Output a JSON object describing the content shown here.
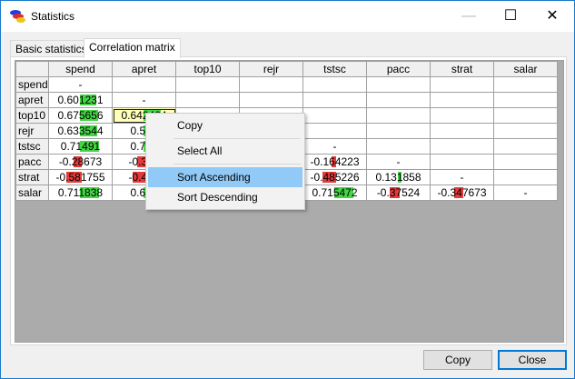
{
  "window": {
    "title": "Statistics"
  },
  "titlebar": {
    "minimize": "—",
    "maximize": "☐",
    "close": "✕"
  },
  "tabs": [
    {
      "label": "Basic statistics",
      "active": false
    },
    {
      "label": "Correlation matrix",
      "active": true
    }
  ],
  "matrix": {
    "columns": [
      "spend",
      "apret",
      "top10",
      "rejr",
      "tstsc",
      "pacc",
      "strat",
      "salar"
    ],
    "rows": [
      {
        "name": "spend",
        "cells": [
          "-",
          "",
          "",
          "",
          "",
          "",
          "",
          ""
        ]
      },
      {
        "name": "apret",
        "cells": [
          "0.601231",
          "-",
          "",
          "",
          "",
          "",
          "",
          ""
        ]
      },
      {
        "name": "top10",
        "cells": [
          "0.675656",
          "0.642464",
          "-",
          "",
          "",
          "",
          "",
          ""
        ]
      },
      {
        "name": "rejr",
        "cells": [
          "0.633544",
          "0.514",
          "",
          "-",
          "",
          "",
          "",
          ""
        ]
      },
      {
        "name": "tstsc",
        "cells": [
          "0.71491",
          "0.782",
          "",
          "",
          "-",
          "",
          "",
          ""
        ]
      },
      {
        "name": "pacc",
        "cells": [
          "-0.28673",
          "-0.302",
          "",
          "",
          "-0.164223",
          "-",
          "",
          ""
        ]
      },
      {
        "name": "strat",
        "cells": [
          "-0.581755",
          "-0.458",
          "",
          "",
          "-0.485226",
          "0.131858",
          "-",
          ""
        ]
      },
      {
        "name": "salar",
        "cells": [
          "0.711838",
          "0.635",
          "",
          "",
          "0.715472",
          "-0.37524",
          "-0.347673",
          "-"
        ]
      }
    ],
    "selected_cell": {
      "row": "top10",
      "column": "apret"
    }
  },
  "context_menu": {
    "items": [
      {
        "label": "Copy"
      },
      {
        "label": "Select All"
      },
      {
        "label": "Sort Ascending",
        "highlighted": true
      },
      {
        "label": "Sort Descending"
      }
    ]
  },
  "buttons": {
    "copy": "Copy",
    "close": "Close"
  },
  "colors": {
    "positive_bar": "#44d544",
    "negative_bar": "#e33b3b",
    "selection": "#ffffb8",
    "menu_highlight": "#91c9f7",
    "accent": "#0078d7"
  }
}
